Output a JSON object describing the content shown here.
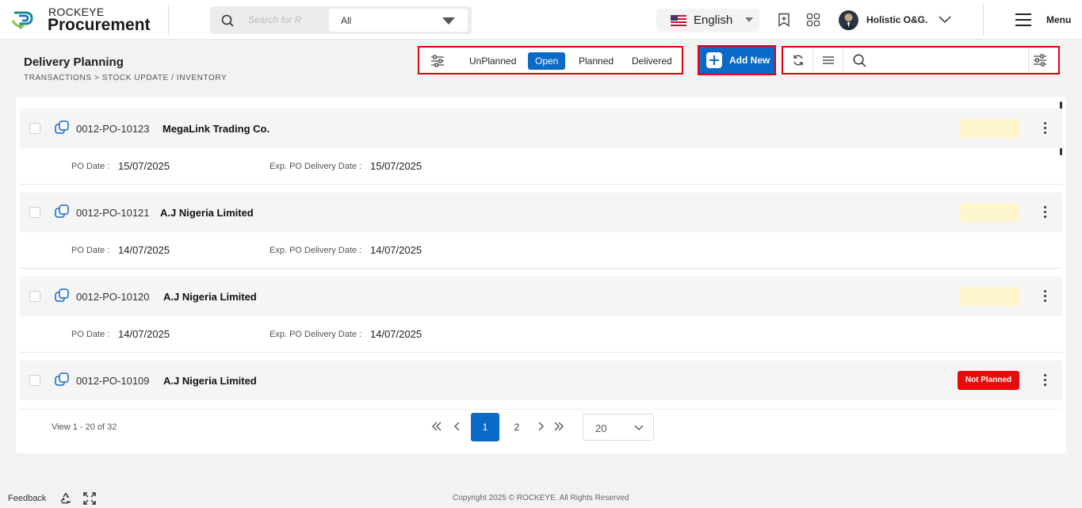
{
  "header": {
    "brand_top": "ROCKEYE",
    "brand_main": "Procurement",
    "search_placeholder": "Search for R",
    "search_scope": "All",
    "language": "English",
    "user_name": "Holistic O&G.",
    "menu_label": "Menu"
  },
  "page": {
    "title": "Delivery Planning",
    "breadcrumb": "TRANSACTIONS >  STOCK UPDATE  /  INVENTORY"
  },
  "filters": {
    "tabs": [
      {
        "label": "UnPlanned",
        "active": false
      },
      {
        "label": "Open",
        "active": true
      },
      {
        "label": "Planned",
        "active": false
      },
      {
        "label": "Delivered",
        "active": false
      }
    ]
  },
  "actions": {
    "add_new_label": "Add New"
  },
  "orders": [
    {
      "po_number": "0012-PO-10123",
      "vendor": "MegaLink Trading Co.",
      "po_date_label": "PO Date :",
      "po_date": "15/07/2025",
      "exp_label": "Exp. PO Delivery Date :",
      "exp_date": "15/07/2025",
      "status": ""
    },
    {
      "po_number": "0012-PO-10121",
      "vendor": "A.J Nigeria Limited",
      "po_date_label": "PO Date :",
      "po_date": "14/07/2025",
      "exp_label": "Exp. PO Delivery Date :",
      "exp_date": "14/07/2025",
      "status": ""
    },
    {
      "po_number": "0012-PO-10120",
      "vendor": "A.J Nigeria Limited",
      "po_date_label": "PO Date :",
      "po_date": "14/07/2025",
      "exp_label": "Exp. PO Delivery Date :",
      "exp_date": "14/07/2025",
      "status": ""
    },
    {
      "po_number": "0012-PO-10109",
      "vendor": "A.J Nigeria Limited",
      "status": "Not Planned"
    }
  ],
  "pagination": {
    "info": "View 1 - 20 of 32",
    "pages": [
      "1",
      "2"
    ],
    "current": "1",
    "page_size": "20"
  },
  "footer": {
    "feedback": "Feedback",
    "copyright": "Copyright 2025 © ROCKEYE. All Rights Reserved"
  },
  "colors": {
    "primary": "#0b69c7",
    "highlight_border": "#e0000f",
    "status_not_planned": "#e70b0b",
    "status_pending": "#fff5cc"
  }
}
